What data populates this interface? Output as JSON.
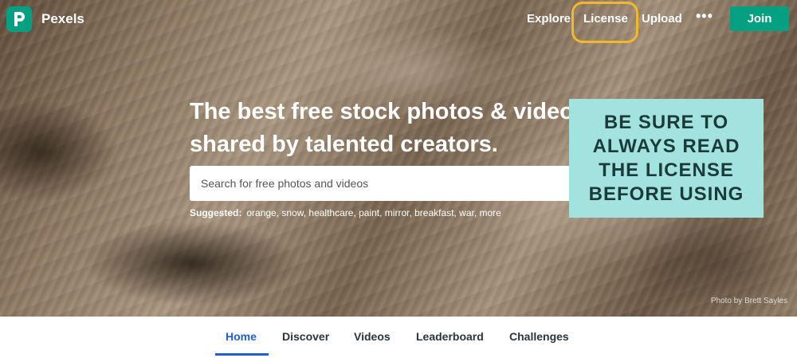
{
  "brand": {
    "name": "Pexels",
    "logo_letter": "P",
    "accent": "#05a081"
  },
  "nav": {
    "explore": "Explore",
    "license": "License",
    "upload": "Upload",
    "more": "•••",
    "join": "Join",
    "highlight_color": "#f1b82c"
  },
  "hero": {
    "headline_line1": "The best free stock photos & videos",
    "headline_line2": "shared by talented creators.",
    "search_placeholder": "Search for free photos and videos",
    "suggested_label": "Suggested:",
    "suggested_terms": "orange, snow, healthcare, paint, mirror, breakfast, war, more",
    "photo_credit": "Photo by Brett Sayles"
  },
  "callout": {
    "line1": "BE SURE TO",
    "line2": "ALWAYS READ",
    "line3": "THE LICENSE",
    "line4": "BEFORE USING",
    "bg_color": "#a3e3df"
  },
  "tabs": {
    "home": "Home",
    "discover": "Discover",
    "videos": "Videos",
    "leaderboard": "Leaderboard",
    "challenges": "Challenges",
    "active_color": "#1f5fd6"
  }
}
